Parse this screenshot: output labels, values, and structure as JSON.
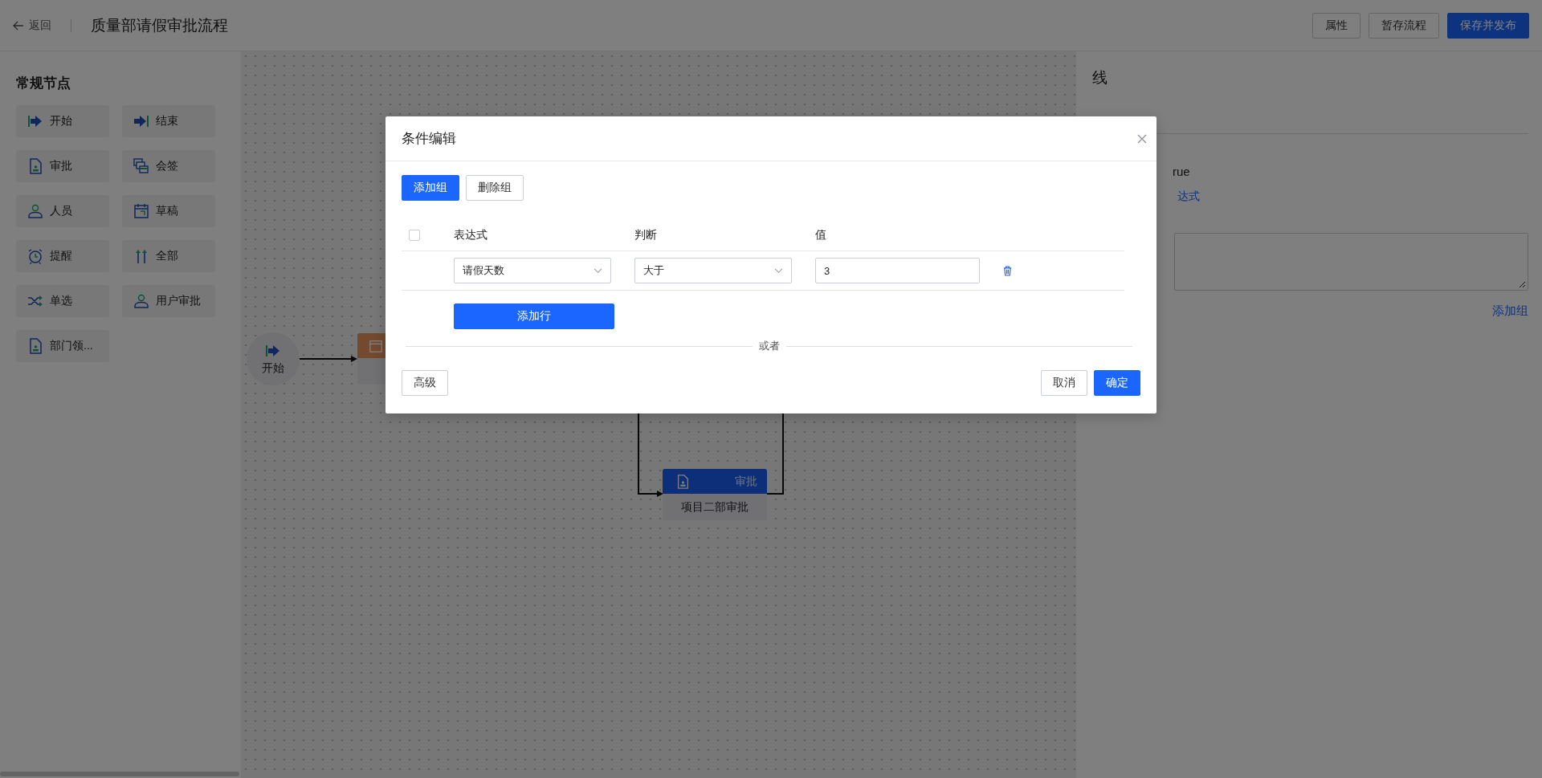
{
  "header": {
    "back": "返回",
    "title": "质量部请假审批流程",
    "buttons": [
      {
        "label": "属性",
        "kind": "default"
      },
      {
        "label": "暂存流程",
        "kind": "default"
      },
      {
        "label": "保存并发布",
        "kind": "primary"
      }
    ]
  },
  "sidebar": {
    "title": "常规节点",
    "items": [
      {
        "label": "开始",
        "kind": "start"
      },
      {
        "label": "结束",
        "kind": "end"
      },
      {
        "label": "审批",
        "kind": "approval"
      },
      {
        "label": "会签",
        "kind": "countersign"
      },
      {
        "label": "人员",
        "kind": "person"
      },
      {
        "label": "草稿",
        "kind": "draft"
      },
      {
        "label": "提醒",
        "kind": "reminder"
      },
      {
        "label": "全部",
        "kind": "all"
      },
      {
        "label": "单选",
        "kind": "choice"
      },
      {
        "label": "用户审批",
        "kind": "person"
      },
      {
        "label": "部门领...",
        "kind": "approval"
      }
    ]
  },
  "canvas": {
    "nodes": [
      {
        "kind": "start",
        "label": "开始"
      },
      {
        "kind": "draft"
      },
      {
        "kind": "approval",
        "type_label": "审批",
        "label": "项目二部审批"
      }
    ]
  },
  "panel": {
    "title": "线",
    "value_fragment": "rue",
    "link_fragment": "达式",
    "add_link": "添加组"
  },
  "modal": {
    "title": "条件编辑",
    "group_buttons": [
      {
        "label": "添加组",
        "kind": "primary"
      },
      {
        "label": "删除组",
        "kind": "default"
      }
    ],
    "all_checked": false,
    "columns": [
      "表达式",
      "判断",
      "值"
    ],
    "rows": [
      {
        "expression": "请假天数",
        "operator": "大于",
        "value": "3"
      }
    ],
    "add_row": "添加行",
    "separator": "或者",
    "footer": {
      "advanced": "高级",
      "cancel": "取消",
      "ok": "确定"
    }
  }
}
